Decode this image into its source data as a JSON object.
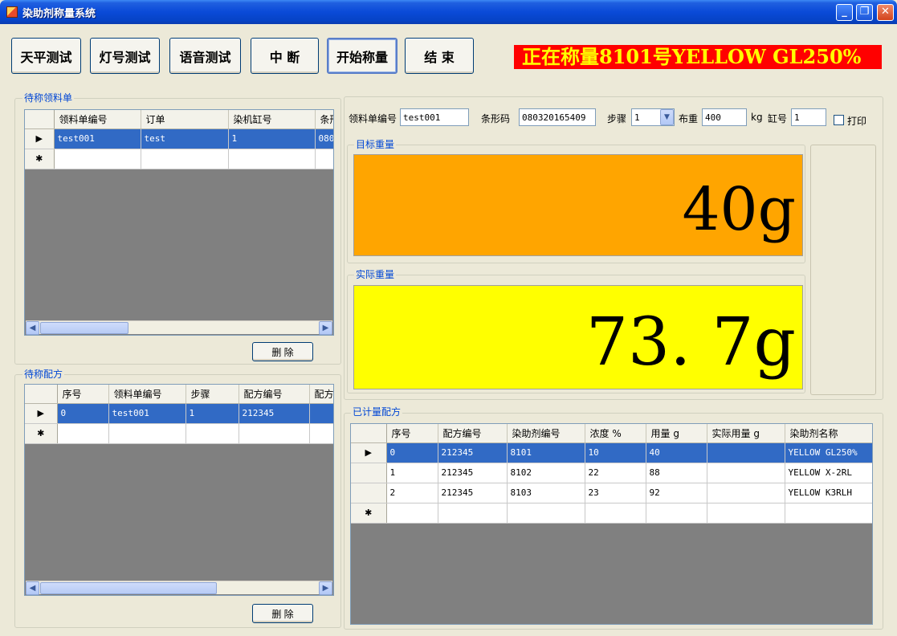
{
  "window": {
    "title": "染助剂称量系统",
    "controls": [
      "_",
      "❐",
      "✕"
    ]
  },
  "toolbar": {
    "buttons": [
      "天平测试",
      "灯号测试",
      "语音测试",
      "中  断",
      "开始称量",
      "结  束"
    ]
  },
  "status_banner": "正在称量8101号YELLOW GL250%",
  "pending_orders": {
    "title": "待称领料单",
    "columns": [
      "领料单编号",
      "订单",
      "染机缸号",
      "条形"
    ],
    "rows": [
      [
        "test001",
        "test",
        "1",
        "080"
      ]
    ],
    "delete_label": "删 除"
  },
  "pending_recipes": {
    "title": "待称配方",
    "columns": [
      "序号",
      "领料单编号",
      "步骤",
      "配方编号",
      "配方"
    ],
    "rows": [
      [
        "0",
        "test001",
        "1",
        "212345",
        ""
      ]
    ],
    "delete_label": "删 除"
  },
  "form": {
    "order_no_label": "领料单编号",
    "order_no": "test001",
    "barcode_label": "条形码",
    "barcode": "080320165409",
    "step_label": "步骤",
    "step": "1",
    "cloth_weight_label": "布重",
    "cloth_weight": "400",
    "cloth_unit": "kg",
    "vat_label": "缸号",
    "vat": "1",
    "print_label": "打印"
  },
  "target_weight": {
    "label": "目标重量",
    "value": "40g"
  },
  "actual_weight": {
    "label": "实际重量",
    "value": "73. 7g"
  },
  "measured": {
    "title": "已计量配方",
    "columns": [
      "序号",
      "配方编号",
      "染助剂编号",
      "浓度 %",
      "用量 g",
      "实际用量 g",
      "染助剂名称"
    ],
    "rows": [
      [
        "0",
        "212345",
        "8101",
        "10",
        "40",
        "",
        "YELLOW GL250%"
      ],
      [
        "1",
        "212345",
        "8102",
        "22",
        "88",
        "",
        "YELLOW X-2RL"
      ],
      [
        "2",
        "212345",
        "8103",
        "23",
        "92",
        "",
        "YELLOW  K3RLH"
      ]
    ]
  },
  "colors": {
    "target_panel": "#ffa500",
    "actual_panel": "#ffff00",
    "banner_bg": "#ff0000",
    "banner_text": "#ffff00",
    "selection": "#316ac5"
  },
  "icons": {
    "row_current": "▶",
    "row_new": "✱",
    "scroll_left": "◀",
    "scroll_right": "▶",
    "combo": "▼"
  }
}
